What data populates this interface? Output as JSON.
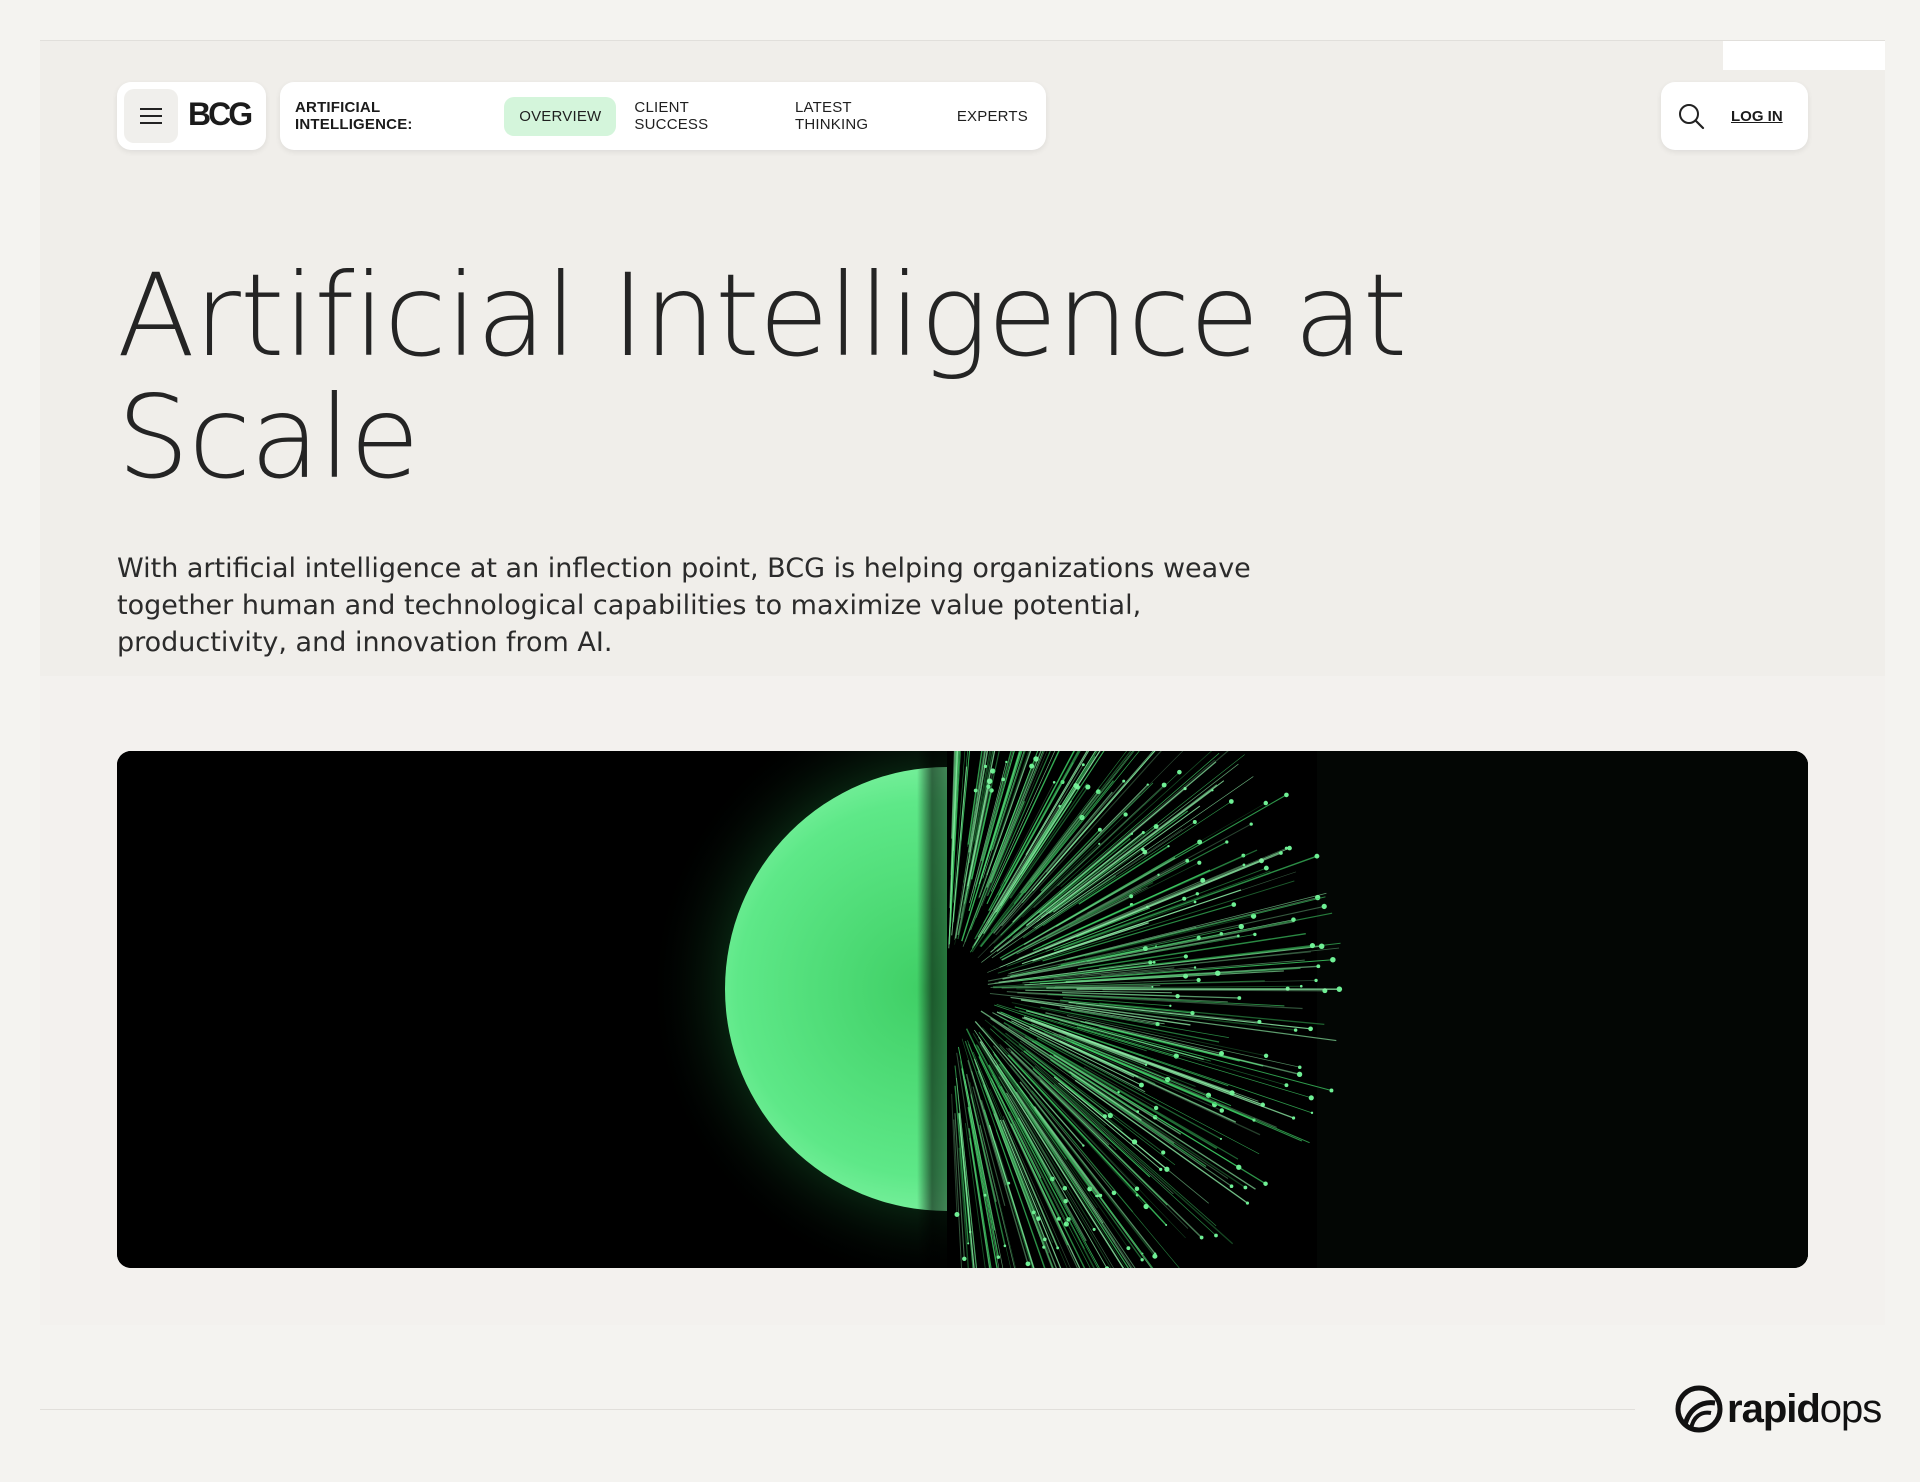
{
  "header": {
    "logo_text": "BCG",
    "section_heading": "ARTIFICIAL INTELLIGENCE:",
    "tabs": [
      {
        "label": "OVERVIEW",
        "active": true
      },
      {
        "label": "CLIENT SUCCESS",
        "active": false
      },
      {
        "label": "LATEST THINKING",
        "active": false
      },
      {
        "label": "EXPERTS",
        "active": false
      }
    ],
    "login_label": "LOG IN",
    "icons": {
      "menu": "hamburger-menu-icon",
      "search": "search-icon"
    }
  },
  "hero": {
    "title_line1": "Artificial Intelligence at",
    "title_line2": "Scale",
    "subtitle": "With artificial intelligence at an inflection point, BCG is helping organizations weave together human and technological capabilities to maximize value potential, productivity, and innovation from AI.",
    "image_description_colors": {
      "accent": "#3dd66b",
      "background": "#000000"
    }
  },
  "footer": {
    "brand_bold": "rapid",
    "brand_light": "ops"
  },
  "colors": {
    "page_bg": "#f4f3f0",
    "frame_bg": "#f0eeea",
    "active_tab_bg": "#d4f5db",
    "text": "#1f1f1f"
  }
}
